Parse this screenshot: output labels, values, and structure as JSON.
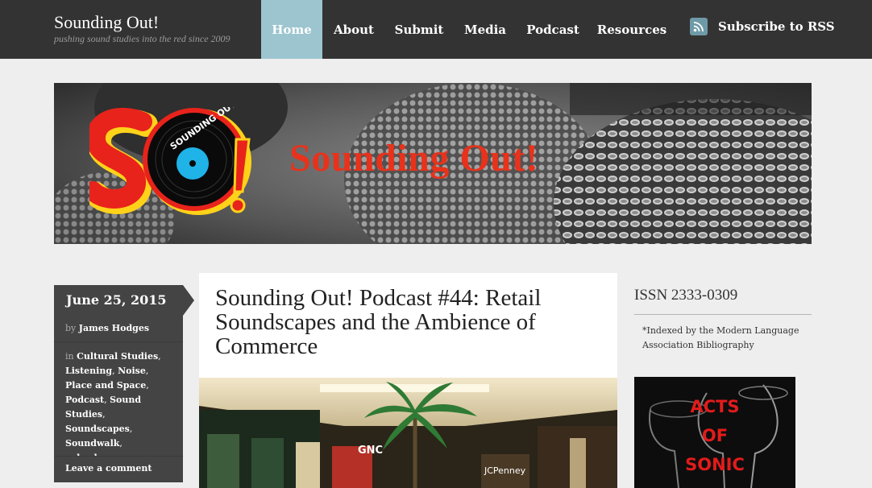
{
  "header": {
    "site_title": "Sounding Out!",
    "tagline": "pushing sound studies into the red since 2009",
    "nav": [
      {
        "label": "Home",
        "active": true
      },
      {
        "label": "About",
        "active": false
      },
      {
        "label": "Submit",
        "active": false
      },
      {
        "label": "Media",
        "active": false
      },
      {
        "label": "Podcast",
        "active": false
      },
      {
        "label": "Resources",
        "active": false
      }
    ],
    "rss_label": "Subscribe to RSS",
    "rss_icon": "rss-icon"
  },
  "banner": {
    "title": "Sounding Out!",
    "logo_record_text": "SOUNDING OUT!"
  },
  "post": {
    "date": "June 25, 2015",
    "author_prefix": "by",
    "author": "James Hodges",
    "categories_prefix": "in",
    "categories": [
      "Cultural Studies",
      "Listening",
      "Noise",
      "Place and Space",
      "Podcast",
      "Sound Studies",
      "Soundscapes",
      "Soundwalk",
      "suburban space"
    ],
    "comment_link": "Leave a comment",
    "title": "Sounding Out! Podcast #44: Retail Soundscapes and the Ambience of Commerce",
    "image_sign_1": "GNC",
    "image_sign_2": "JCPenney"
  },
  "sidebar": {
    "issn": "ISSN 2333-0309",
    "index_note": "*Indexed by the Modern Language Association Bibliography",
    "ad_lines": [
      "ACTS",
      "OF",
      "SONIC"
    ]
  },
  "colors": {
    "header_bg": "#333333",
    "nav_active": "#9cc5d0",
    "accent_red": "#e8321b",
    "meta_bg": "#444444"
  }
}
